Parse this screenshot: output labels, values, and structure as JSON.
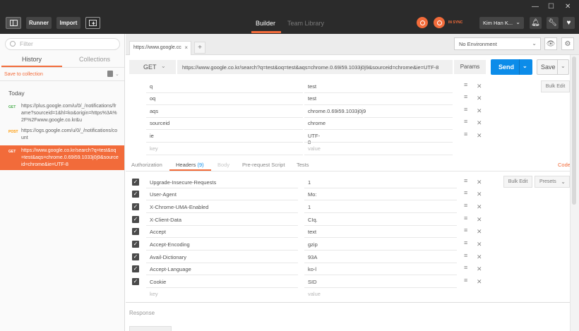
{
  "titlebar": {
    "runner": "Runner",
    "import": "Import",
    "tabs": [
      "Builder",
      "Team Library"
    ],
    "sync": "IN SYNC",
    "user": "Kim Han K..."
  },
  "sidebar": {
    "filter_placeholder": "Filter",
    "tabs": [
      "History",
      "Collections"
    ],
    "save_to_collection": "Save to collection",
    "group": "Today",
    "items": [
      {
        "method": "GET",
        "url": "https://plus.google.com/u/0/_/notifications/frame?sourceid=1&hl=ko&origin=https%3A%2F%2Fwww.google.co.kr&u"
      },
      {
        "method": "POST",
        "url": "https://ogs.google.com/u/0/_/notifications/count"
      },
      {
        "method": "GET",
        "url": "https://www.google.co.kr/search?q=test&oq=test&aqs=chrome.0.69i59.1033j0j9&sourceid=chrome&ie=UTF-8"
      }
    ]
  },
  "request_tab": {
    "label": "https://www.google.cc",
    "add": "+"
  },
  "environment": {
    "selected": "No Environment"
  },
  "request": {
    "method": "GET",
    "url": "https://www.google.co.kr/search?q=test&oq=test&aqs=chrome.0.69i59.1033j0j9&sourceid=chrome&ie=UTF-8",
    "params": "Params",
    "send": "Send",
    "save": "Save"
  },
  "params": {
    "bulk_edit": "Bulk Edit",
    "rows": [
      {
        "key": "q",
        "value": "test"
      },
      {
        "key": "oq",
        "value": "test"
      },
      {
        "key": "aqs",
        "value": "chrome.0.69i59.1033j0j9"
      },
      {
        "key": "sourceid",
        "value": "chrome"
      },
      {
        "key": "ie",
        "value": "UTF-8"
      }
    ],
    "key_placeholder": "key",
    "value_placeholder": "value"
  },
  "subtabs": {
    "authorization": "Authorization",
    "headers": "Headers",
    "headers_count": "(9)",
    "body": "Body",
    "prerequest": "Pre-request Script",
    "tests": "Tests",
    "code": "Code"
  },
  "headers": {
    "bulk_edit": "Bulk Edit",
    "presets": "Presets",
    "rows": [
      {
        "key": "Upgrade-Insecure-Requests",
        "value": "1"
      },
      {
        "key": "User-Agent",
        "value": "Mo:"
      },
      {
        "key": "X-Chrome-UMA-Enabled",
        "value": "1"
      },
      {
        "key": "X-Client-Data",
        "value": "CIq."
      },
      {
        "key": "Accept",
        "value": "text"
      },
      {
        "key": "Accept-Encoding",
        "value": "gzip"
      },
      {
        "key": "Avail-Dictionary",
        "value": "93A"
      },
      {
        "key": "Accept-Language",
        "value": "ko-l"
      },
      {
        "key": "Cookie",
        "value": "SID"
      }
    ],
    "key_placeholder": "key",
    "value_placeholder": "value"
  },
  "response": {
    "label": "Response"
  },
  "colors": {
    "accent": "#f26b3a",
    "send": "#0c8ce9",
    "titlebar": "#2b2b2b"
  }
}
